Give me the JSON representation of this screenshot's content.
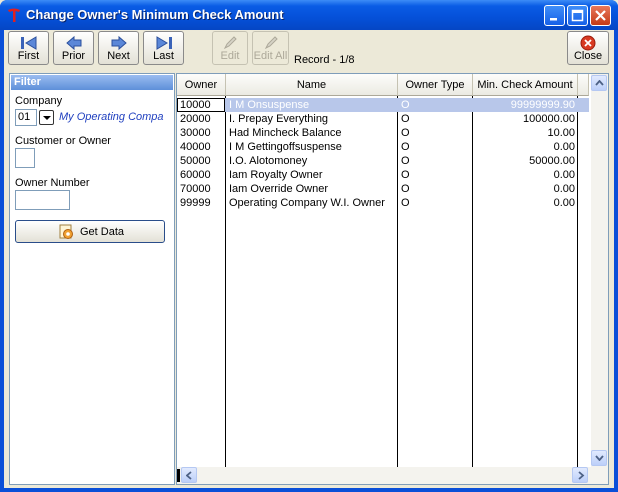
{
  "window": {
    "title": "Change Owner's Minimum Check Amount"
  },
  "toolbar": {
    "first": "First",
    "prior": "Prior",
    "next": "Next",
    "last": "Last",
    "edit": "Edit",
    "edit_all": "Edit All",
    "close": "Close",
    "record": "Record - 1/8"
  },
  "filter": {
    "header": "Filter",
    "company_label": "Company",
    "company_code": "01",
    "company_name": "My Operating Compa",
    "customer_label": "Customer or Owner",
    "owner_number_label": "Owner Number",
    "get_data": "Get Data"
  },
  "grid": {
    "columns": [
      "Owner",
      "Name",
      "Owner Type",
      "Min. Check Amount"
    ],
    "rows": [
      {
        "owner": "10000",
        "name": "I M Onsuspense",
        "type": "O",
        "amount": "99999999.90"
      },
      {
        "owner": "20000",
        "name": "I. Prepay Everything",
        "type": "O",
        "amount": "100000.00"
      },
      {
        "owner": "30000",
        "name": "Had Mincheck Balance",
        "type": "O",
        "amount": "10.00"
      },
      {
        "owner": "40000",
        "name": "I M Gettingoffsuspense",
        "type": "O",
        "amount": "0.00"
      },
      {
        "owner": "50000",
        "name": "I.O. Alotomoney",
        "type": "O",
        "amount": "50000.00"
      },
      {
        "owner": "60000",
        "name": "Iam Royalty Owner",
        "type": "O",
        "amount": "0.00"
      },
      {
        "owner": "70000",
        "name": "Iam Override Owner",
        "type": "O",
        "amount": "0.00"
      },
      {
        "owner": "99999",
        "name": "Operating Company W.I.  Owner",
        "type": "O",
        "amount": "0.00"
      }
    ]
  },
  "colors": {
    "title_bar": "#0550d8",
    "selection": "#b8c7ea",
    "link": "#1f3fbf"
  }
}
